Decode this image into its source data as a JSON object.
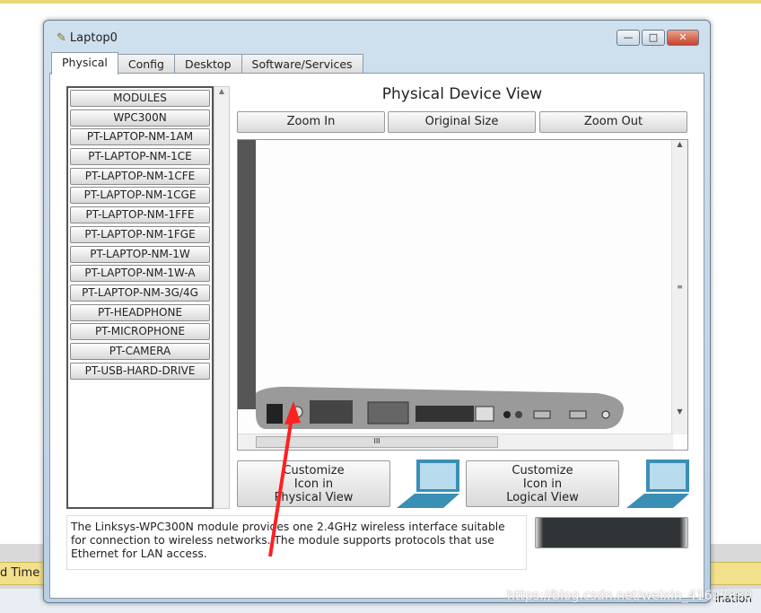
{
  "window": {
    "title": "Laptop0",
    "controls": {
      "minimize": "—",
      "maximize": "□",
      "close": "✕"
    }
  },
  "tabs": [
    {
      "label": "Physical",
      "active": true
    },
    {
      "label": "Config"
    },
    {
      "label": "Desktop"
    },
    {
      "label": "Software/Services"
    }
  ],
  "modules": [
    "MODULES",
    "WPC300N",
    "PT-LAPTOP-NM-1AM",
    "PT-LAPTOP-NM-1CE",
    "PT-LAPTOP-NM-1CFE",
    "PT-LAPTOP-NM-1CGE",
    "PT-LAPTOP-NM-1FFE",
    "PT-LAPTOP-NM-1FGE",
    "PT-LAPTOP-NM-1W",
    "PT-LAPTOP-NM-1W-A",
    "PT-LAPTOP-NM-3G/4G",
    "PT-HEADPHONE",
    "PT-MICROPHONE",
    "PT-CAMERA",
    "PT-USB-HARD-DRIVE"
  ],
  "view": {
    "title": "Physical Device View",
    "zoom_in": "Zoom In",
    "original_size": "Original Size",
    "zoom_out": "Zoom Out",
    "hscroll_grip": "III",
    "vscroll_grip": "≡"
  },
  "customize_physical": [
    "Customize",
    "Icon in",
    "Physical View"
  ],
  "customize_logical": [
    "Customize",
    "Icon in",
    "Logical View"
  ],
  "description": "The Linksys-WPC300N module provides one 2.4GHz wireless interface suitable for connection to wireless networks. The module supports protocols that use Ethernet for LAN access.",
  "background": {
    "left_text": "d Time",
    "right_text": "ination"
  },
  "watermark": "https://blog.csdn.net/weixin_41627830",
  "colors": {
    "annotation_arrow": "#ff2020",
    "laptop_icon": "#3a8fb5"
  }
}
